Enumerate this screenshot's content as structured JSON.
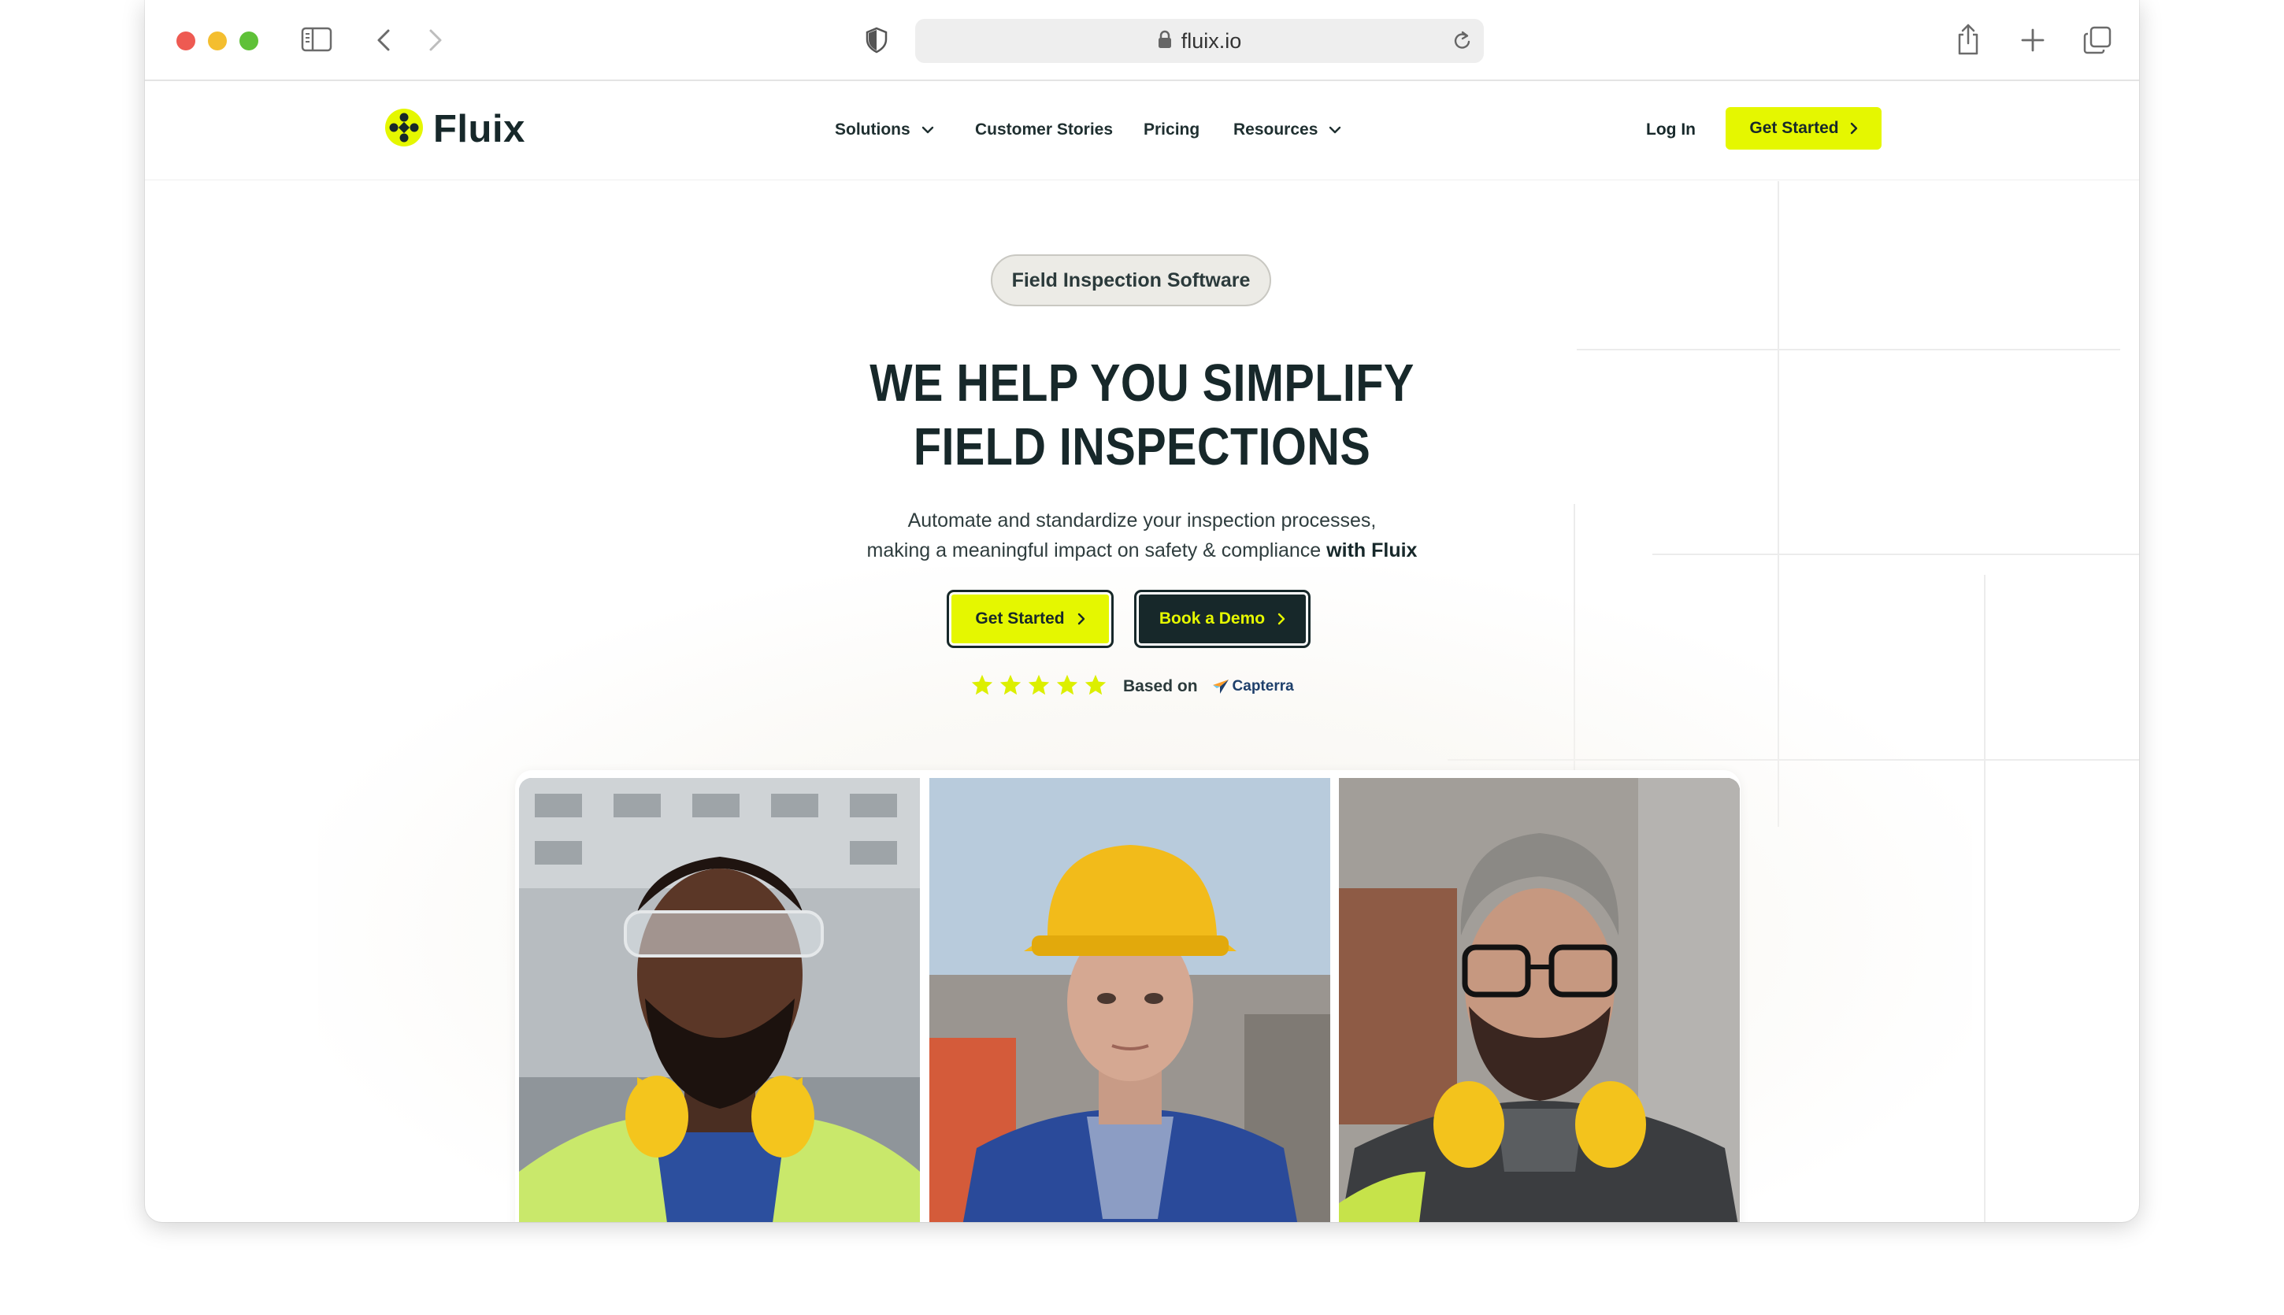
{
  "browser": {
    "url": "fluix.io",
    "icons": [
      "sidebar-icon",
      "back-icon",
      "forward-icon",
      "shield-icon",
      "lock-icon",
      "reload-icon",
      "share-icon",
      "new-tab-icon",
      "tabs-overview-icon"
    ]
  },
  "site": {
    "logo_text": "Fluix",
    "nav": {
      "solutions": "Solutions",
      "customer_stories": "Customer Stories",
      "pricing": "Pricing",
      "resources": "Resources",
      "login": "Log In",
      "get_started": "Get Started"
    }
  },
  "hero": {
    "badge": "Field Inspection Software",
    "headline_line1": "WE HELP YOU SIMPLIFY",
    "headline_line2": "FIELD INSPECTIONS",
    "sub_line1": "Automate and standardize your inspection processes,",
    "sub_line2": "making a meaningful impact on safety & compliance",
    "sub_bold": "with Fluix",
    "cta_primary": "Get Started",
    "cta_secondary": "Book a Demo",
    "rating": {
      "stars": 5,
      "based_on": "Based on",
      "source": "Capterra"
    }
  },
  "photos": [
    {
      "subject": "worker with safety glasses, beard and yellow ear defenders"
    },
    {
      "subject": "woman in yellow hard hat and blue workwear"
    },
    {
      "subject": "man with glasses, beard and yellow ear defenders"
    }
  ],
  "colors": {
    "brand_yellow": "#e5f700",
    "brand_dark": "#17282a",
    "badge_bg": "#ecebe6"
  }
}
